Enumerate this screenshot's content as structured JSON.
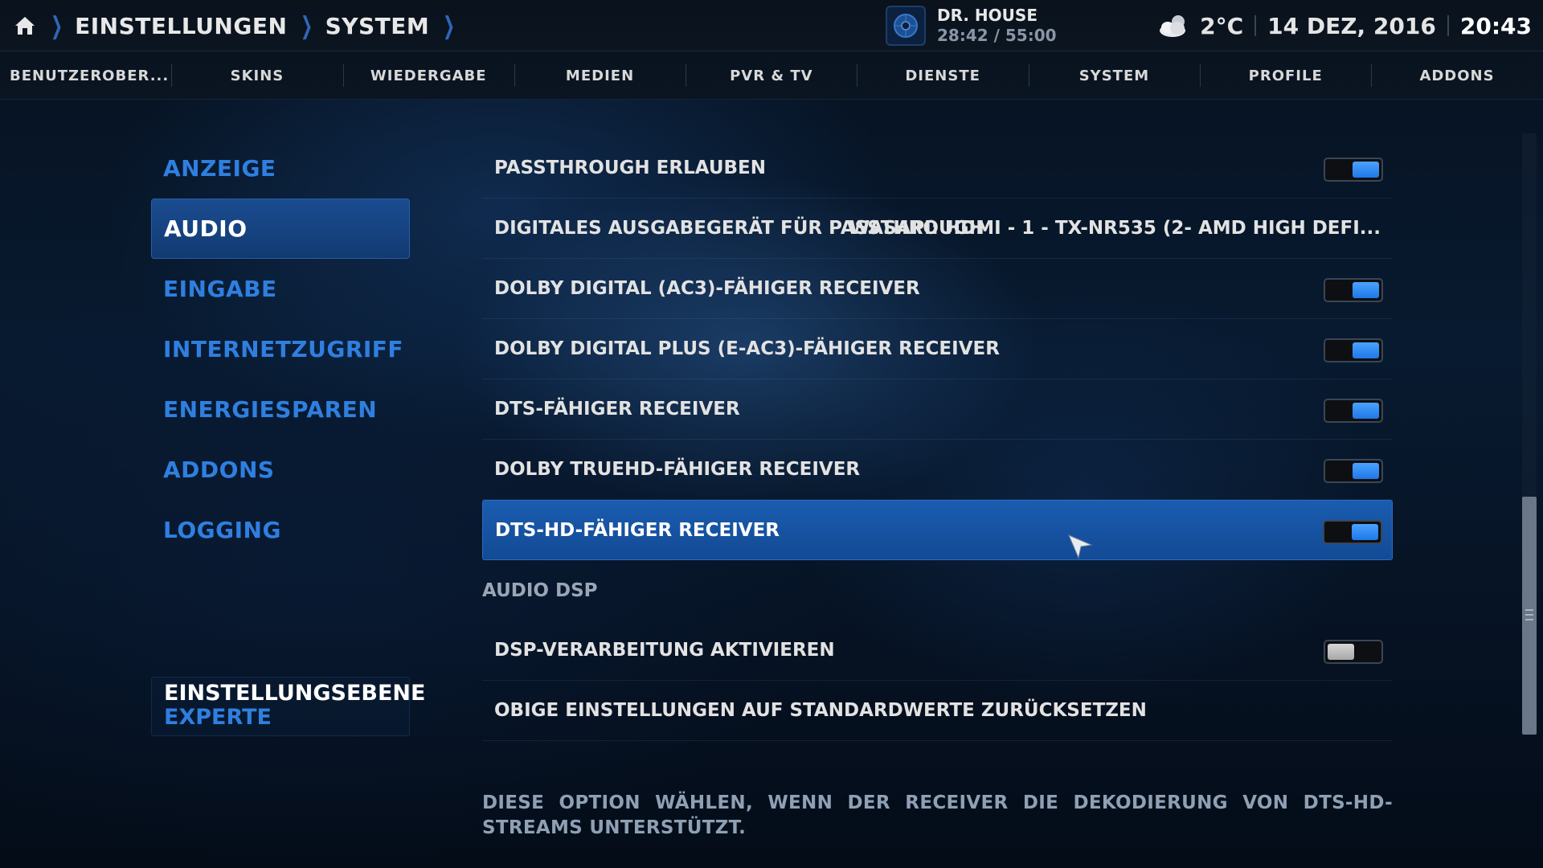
{
  "breadcrumb": {
    "items": [
      "EINSTELLUNGEN",
      "SYSTEM"
    ]
  },
  "now_playing": {
    "title": "DR. HOUSE",
    "time": "28:42 / 55:00"
  },
  "status": {
    "temperature": "2°C",
    "date": "14 DEZ, 2016",
    "clock": "20:43",
    "weather_icon": "cloud-sun-icon"
  },
  "tabs": [
    "BENUTZEROBER...",
    "SKINS",
    "WIEDERGABE",
    "MEDIEN",
    "PVR & TV",
    "DIENSTE",
    "SYSTEM",
    "PROFILE",
    "ADDONS"
  ],
  "categories": [
    "ANZEIGE",
    "AUDIO",
    "EINGABE",
    "INTERNETZUGRIFF",
    "ENERGIESPAREN",
    "ADDONS",
    "LOGGING"
  ],
  "active_category": "AUDIO",
  "settings_level": {
    "title": "EINSTELLUNGSEBENE",
    "value": "EXPERTE"
  },
  "settings": [
    {
      "label": "PASSTHROUGH ERLAUBEN",
      "toggle": true
    },
    {
      "label": "DIGITALES AUSGABEGERÄT FÜR PASSTHROUGH",
      "value": "WASAPI: HDMI - 1 - TX-NR535 (2- AMD HIGH DEFI..."
    },
    {
      "label": "DOLBY DIGITAL (AC3)-FÄHIGER RECEIVER",
      "toggle": true
    },
    {
      "label": "DOLBY DIGITAL PLUS (E-AC3)-FÄHIGER RECEIVER",
      "toggle": true
    },
    {
      "label": "DTS-FÄHIGER RECEIVER",
      "toggle": true
    },
    {
      "label": "DOLBY TRUEHD-FÄHIGER RECEIVER",
      "toggle": true
    },
    {
      "label": "DTS-HD-FÄHIGER RECEIVER",
      "toggle": true,
      "selected": true
    }
  ],
  "dsp_section": {
    "heading": "AUDIO DSP",
    "items": [
      {
        "label": "DSP-VERARBEITUNG AKTIVIEREN",
        "toggle": false
      },
      {
        "label": "OBIGE EINSTELLUNGEN AUF STANDARDWERTE ZURÜCKSETZEN"
      }
    ]
  },
  "description": "DIESE OPTION WÄHLEN, WENN DER RECEIVER DIE DEKODIERUNG VON DTS-HD-STREAMS UNTERSTÜTZT.",
  "colors": {
    "accent": "#2f7fe0",
    "selection": "#1a5cb0",
    "toggle_on": "#2f8cf5"
  }
}
